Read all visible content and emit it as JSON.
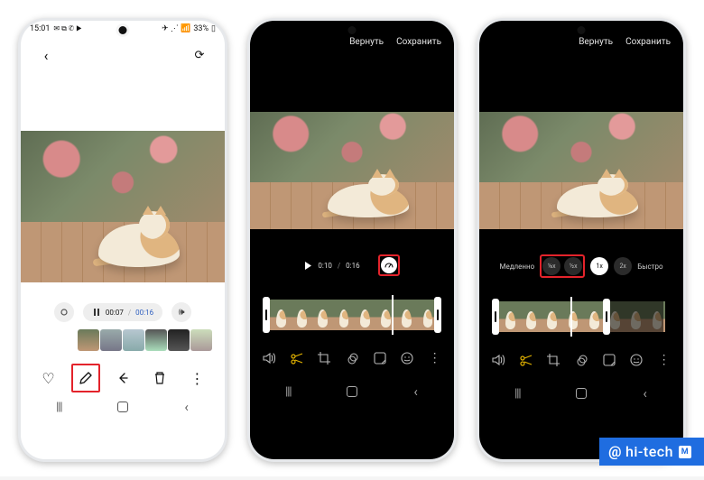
{
  "phone1": {
    "status": {
      "time": "15:01",
      "left_icons": "✉︎ ⧉ ✆ ▶",
      "right_icons": "✈ ⋰ 📶",
      "battery": "33%"
    },
    "header": {
      "back": "‹",
      "rotate": "⟳"
    },
    "playback": {
      "current": "00:07",
      "total": "00:16"
    },
    "actions": {
      "favorite": "♡",
      "edit": "✎",
      "share": "‹",
      "delete": "🗑",
      "more": "⋮"
    },
    "nav": {
      "recents": "|||",
      "back": "‹"
    }
  },
  "phone2": {
    "header": {
      "revert": "Вернуть",
      "save": "Сохранить"
    },
    "play": {
      "icon": "▶",
      "current": "0:10",
      "total": "0:16"
    },
    "speed_icon": "⏱",
    "tools": {
      "mute": "🕨",
      "trim": "✂",
      "crop": "⤡",
      "filter": "ᢁ",
      "decor": "⊕",
      "emoji": "☺",
      "more": "⋮"
    },
    "nav": {
      "recents": "|||",
      "back": "‹"
    }
  },
  "phone3": {
    "header": {
      "revert": "Вернуть",
      "save": "Сохранить"
    },
    "speed": {
      "slow_label": "Медленно",
      "fast_label": "Быстро",
      "opts": {
        "eighth": "⅛x",
        "half": "½x",
        "one": "1x",
        "two": "2x"
      }
    },
    "tools": {
      "mute": "🕨",
      "trim": "✂",
      "crop": "⤡",
      "filter": "ᢁ",
      "decor": "⊕",
      "emoji": "☺",
      "more": "⋮"
    },
    "nav": {
      "recents": "|||",
      "back": "‹"
    }
  },
  "watermark": {
    "at": "@",
    "text": "hi-tech",
    "badge": "M"
  }
}
